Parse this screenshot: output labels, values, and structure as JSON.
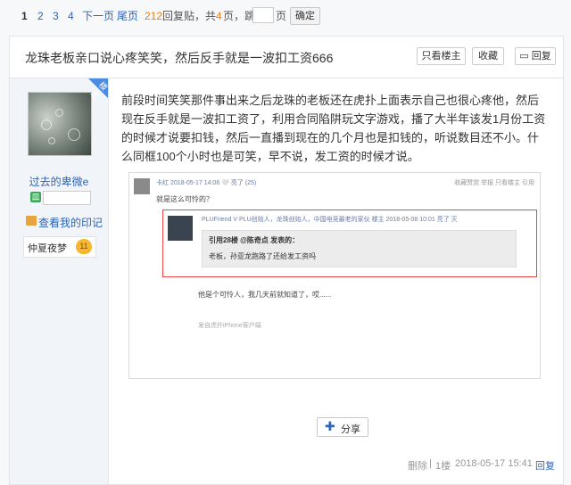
{
  "pager": {
    "pages": [
      "1",
      "2",
      "3",
      "4"
    ],
    "next": "下一页",
    "last": "尾页",
    "reply_count": "212",
    "reply_label": "回复贴，共",
    "total_pages": "4",
    "pages_suffix": "页，跳到",
    "page_unit": "页",
    "confirm": "确定"
  },
  "thread": {
    "title": "龙珠老板亲口说心疼笑笑，然后反手就是一波扣工资666",
    "only_op": "只看楼主",
    "favorite": "收藏",
    "reply": "回复"
  },
  "author": {
    "corner_badge": "楼主",
    "name": "过去的卑微e",
    "level_icon": "皿",
    "my_marks": "查看我的印记",
    "badge_name": "仲夏夜梦",
    "badge_level": "11"
  },
  "post": {
    "body": "前段时间笑笑那件事出来之后龙珠的老板还在虎扑上面表示自己也很心疼他，然后现在反手就是一波扣工资了，利用合同陷阱玩文字游戏，播了大半年该发1月份工资的时候才说要扣钱，然后一直播到现在的几个月也是扣钱的，听说数目还不小。什么同框100个小时也是可笑，早不说，发工资的时候才说。"
  },
  "screenshot": {
    "user": "卡红  2018-05-17 14:06  🤍 亮了 (25)",
    "actions": "收藏赞赏  举报  只看楼主  引用",
    "question": "就是这么可怜的？",
    "quote_user": "PLUFriend  V  PLU创始人，龙珠创始人，中国电竞最老的家伙  楼主  2018-05-08 10:01  亮了  灭",
    "quote_head": "引用28楼 @陈奇点 发表的：",
    "quote_text": "老板，孙亚龙跑路了还给发工资吗",
    "reply_text": "他是个可怜人，我几天前就知道了，哎......",
    "source": "发自虎扑iPhone客户端"
  },
  "share": {
    "label": "分享"
  },
  "footer": {
    "delete": "删除",
    "floor": "1楼",
    "time": "2018-05-17 15:41",
    "reply": "回复"
  },
  "colors": {
    "link": "#2d64b3",
    "count": "#f07c0e",
    "quote_border": "#e44444"
  }
}
